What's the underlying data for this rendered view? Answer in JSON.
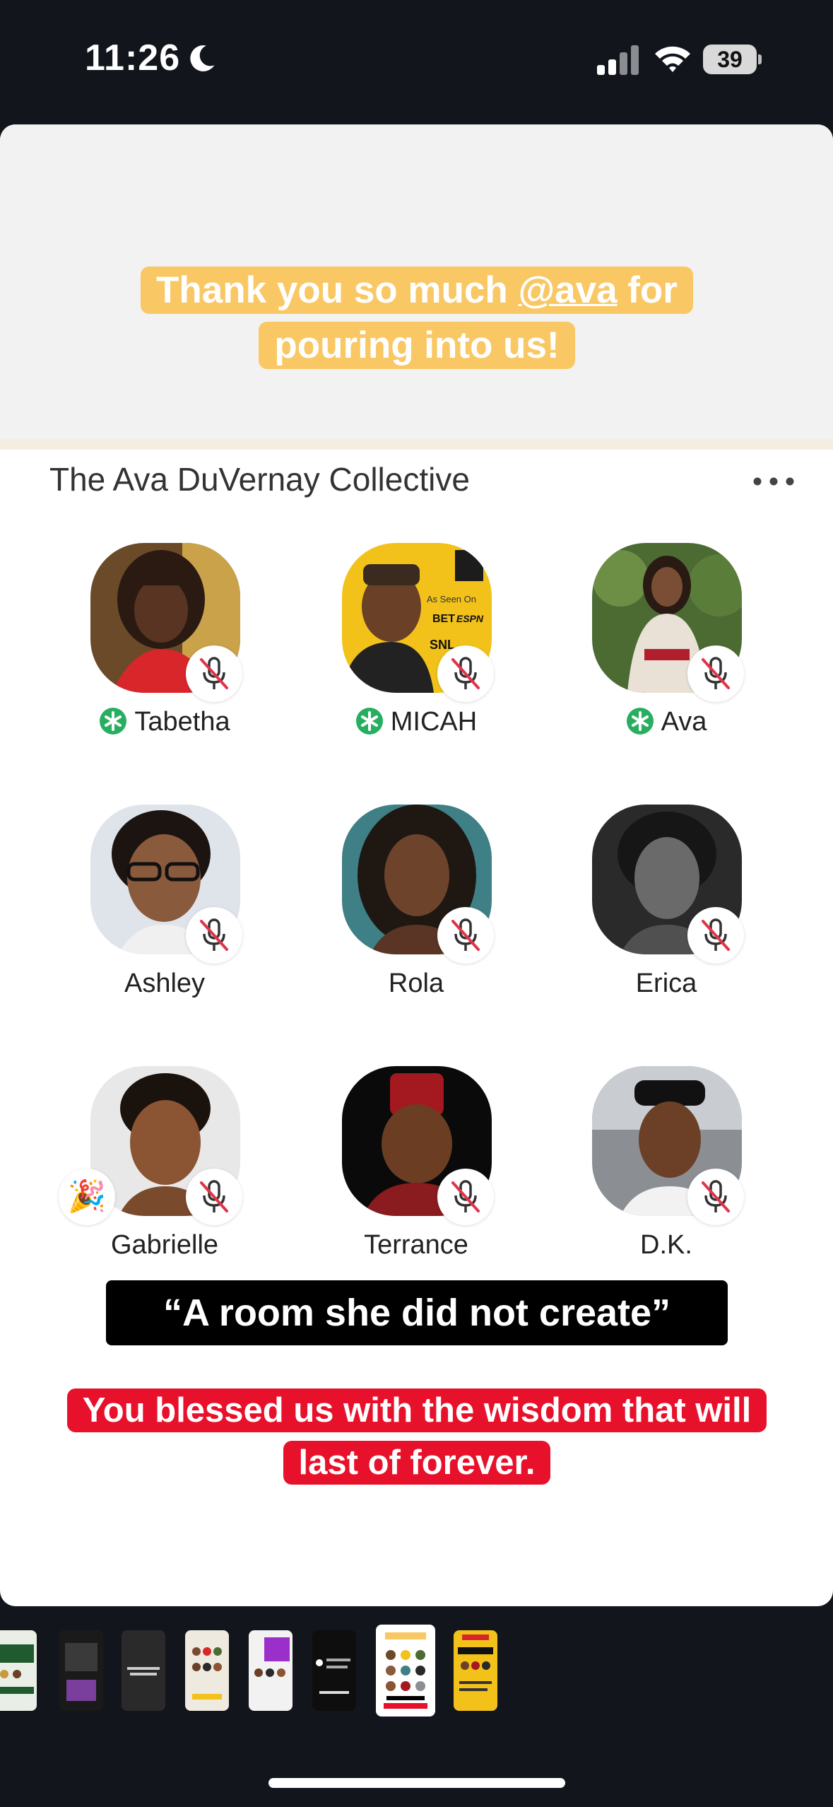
{
  "status_bar": {
    "time": "11:26",
    "battery": "39",
    "icons": [
      "moon-icon",
      "cellular-signal-icon",
      "wifi-icon",
      "battery-icon"
    ]
  },
  "story": {
    "top_sticker": {
      "before": "Thank you so much ",
      "mention": "@ava",
      "after": " for pouring into us!",
      "color": "#f9c865"
    },
    "room": {
      "title": "The Ava DuVernay Collective",
      "more_icon": "ellipsis-icon",
      "speakers": [
        {
          "name": "Tabetha",
          "moderator": true,
          "party": false
        },
        {
          "name": "MICAH",
          "moderator": true,
          "party": false
        },
        {
          "name": "Ava",
          "moderator": true,
          "party": false
        },
        {
          "name": "Ashley",
          "moderator": false,
          "party": false
        },
        {
          "name": "Rola",
          "moderator": false,
          "party": false
        },
        {
          "name": "Erica",
          "moderator": false,
          "party": false
        },
        {
          "name": "Gabrielle",
          "moderator": false,
          "party": true
        },
        {
          "name": "Terrance",
          "moderator": false,
          "party": false
        },
        {
          "name": "D.K.",
          "moderator": false,
          "party": false
        }
      ],
      "micah_badges": [
        "As Seen On",
        "BET",
        "ESPN",
        "SNL"
      ]
    },
    "quote_caption": "“A room she did not create”",
    "bottom_sticker": {
      "text": "You blessed us with the wisdom that will last of forever.",
      "color": "#e8112b"
    }
  },
  "thumbnails": {
    "count": 8,
    "active_index": 6
  },
  "colors": {
    "background": "#12161c",
    "moderator_green": "#27ae60",
    "mute_red": "#e0344a"
  }
}
